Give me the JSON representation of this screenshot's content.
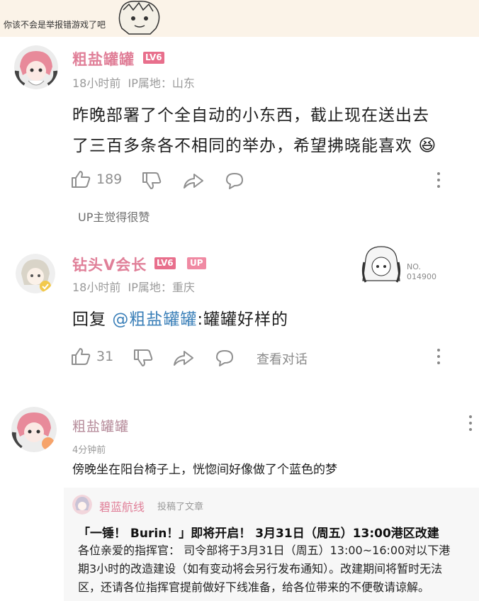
{
  "caption": "你该不会是举报错游戏了吧",
  "comment1": {
    "username": "粗盐罐罐",
    "level": "LV6",
    "time": "18小时前",
    "ip": "IP属地：山东",
    "text_line1": "昨晚部署了个全自动的小东西，截止现在送出去",
    "text_line2": "了三百多条各不相同的举办，希望拂晓能喜欢",
    "emoji": "😆",
    "like_count": "189",
    "up_liked": "UP主觉得很赞"
  },
  "comment2": {
    "username": "钻头V会长",
    "level": "LV6",
    "up_badge": "UP",
    "time": "18小时前",
    "ip": "IP属地：重庆",
    "reply_prefix": "回复 ",
    "mention": "@粗盐罐罐",
    "reply_text": ":罐罐好样的",
    "like_count": "31",
    "view_chat": "查看对话",
    "card_no_label": "NO.",
    "card_no": "014900"
  },
  "comment3": {
    "username": "粗盐罐罐",
    "time": "4分钟前",
    "text": "傍晚坐在阳台椅子上，恍惚间好像做了个蓝色的梦",
    "repost": {
      "author": "碧蓝航线",
      "action": "投稿了文章",
      "title": "「一锤！ Burin！」即将开启！ 3月31日（周五）13:00港区改建",
      "body_line1": "各位亲爱的指挥官：  司令部将于3月31日（周五）13:00~16:00对以下港",
      "body_line2": "期3小时的改造建设（如有变动将会另行发布通知）。改建期间将暂时无法",
      "body_line3": "区，还请各位指挥官提前做好下线准备，给各位带来的不便敬请谅解。"
    }
  },
  "colors": {
    "username_pink": "#e07f98",
    "mention_blue": "#3a7fb8",
    "meta_grey": "#9a9a9a",
    "banner_bg": "#fbf3e8"
  },
  "icons": [
    "thumb-up-icon",
    "thumb-down-icon",
    "share-icon",
    "comment-icon",
    "more-icon"
  ]
}
